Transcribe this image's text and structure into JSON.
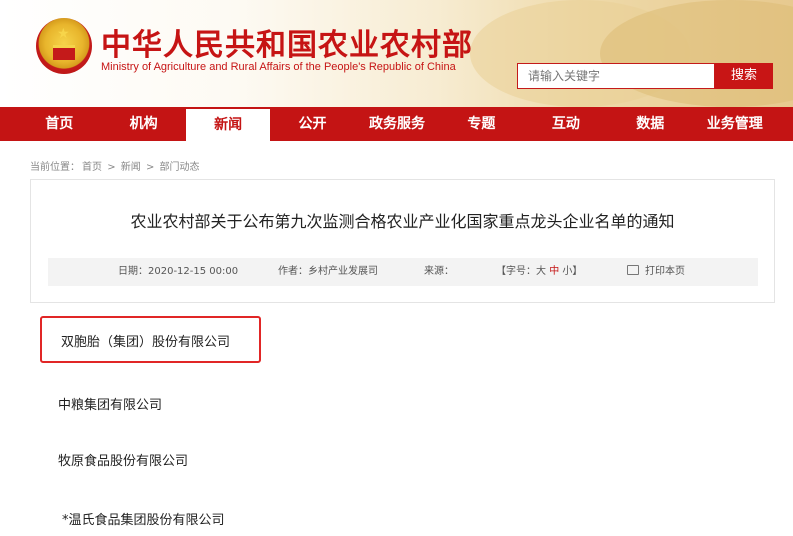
{
  "header": {
    "title": "中华人民共和国农业农村部",
    "subtitle": "Ministry of Agriculture and Rural Affairs of the People's Republic of China",
    "search_placeholder": "请输入关键字",
    "search_button": "搜索",
    "brand_color": "#c41414"
  },
  "nav": {
    "items": [
      "首页",
      "机构",
      "新闻",
      "公开",
      "政务服务",
      "专题",
      "互动",
      "数据",
      "业务管理"
    ],
    "active": "新闻"
  },
  "breadcrumb": {
    "prefix": "当前位置：",
    "items": [
      "首页",
      "新闻",
      "部门动态"
    ],
    "sep": ">"
  },
  "article": {
    "title": "农业农村部关于公布第九次监测合格农业产业化国家重点龙头企业名单的通知",
    "date_label": "日期：",
    "date": "2020-12-15 00:00",
    "author_label": "作者：",
    "author": "乡村产业发展司",
    "source_label": "来源：",
    "font_size_label": "【字号：",
    "font_large": "大",
    "font_medium": "中",
    "font_small": "小",
    "font_close": "】",
    "print_label": "打印本页"
  },
  "companies": [
    "双胞胎（集团）股份有限公司",
    "中粮集团有限公司",
    "牧原食品股份有限公司",
    "*温氏食品集团股份有限公司"
  ]
}
